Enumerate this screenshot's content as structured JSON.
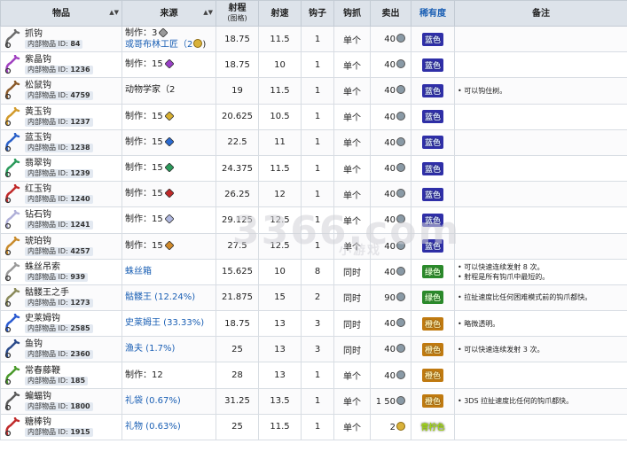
{
  "headers": {
    "item": "物品",
    "source": "来源",
    "range": "射程",
    "range_sub": "(图格)",
    "velocity": "射速",
    "hooks": "钩子",
    "latching": "钩抓",
    "sell": "卖出",
    "rarity": "稀有度",
    "notes": "备注"
  },
  "watermark": "3366.com",
  "watermark_sub": "小游戏",
  "rows": [
    {
      "name": "抓钩",
      "id_label": "内部物品 ID:",
      "id": "84",
      "src1": "制作：3",
      "src2": "或哥布林工匠（2",
      "range": "18.75",
      "vel": "11.5",
      "hooks": "1",
      "latch": "单个",
      "sell": "40",
      "rarity": "蓝色",
      "note1": "",
      "note2": ""
    },
    {
      "name": "紫晶钩",
      "id_label": "内部物品 ID:",
      "id": "1236",
      "src1": "制作：15",
      "src2": "",
      "range": "18.75",
      "vel": "10",
      "hooks": "1",
      "latch": "单个",
      "sell": "40",
      "rarity": "蓝色",
      "note1": "",
      "note2": ""
    },
    {
      "name": "松鼠钩",
      "id_label": "内部物品 ID:",
      "id": "4759",
      "src1": "动物学家（2",
      "src2": "",
      "range": "19",
      "vel": "11.5",
      "hooks": "1",
      "latch": "单个",
      "sell": "40",
      "rarity": "蓝色",
      "note1": "可以钩住树。",
      "note2": ""
    },
    {
      "name": "黄玉钩",
      "id_label": "内部物品 ID:",
      "id": "1237",
      "src1": "制作：15",
      "src2": "",
      "range": "20.625",
      "vel": "10.5",
      "hooks": "1",
      "latch": "单个",
      "sell": "40",
      "rarity": "蓝色",
      "note1": "",
      "note2": ""
    },
    {
      "name": "蓝玉钩",
      "id_label": "内部物品 ID:",
      "id": "1238",
      "src1": "制作：15",
      "src2": "",
      "range": "22.5",
      "vel": "11",
      "hooks": "1",
      "latch": "单个",
      "sell": "40",
      "rarity": "蓝色",
      "note1": "",
      "note2": ""
    },
    {
      "name": "翡翠钩",
      "id_label": "内部物品 ID:",
      "id": "1239",
      "src1": "制作：15",
      "src2": "",
      "range": "24.375",
      "vel": "11.5",
      "hooks": "1",
      "latch": "单个",
      "sell": "40",
      "rarity": "蓝色",
      "note1": "",
      "note2": ""
    },
    {
      "name": "红玉钩",
      "id_label": "内部物品 ID:",
      "id": "1240",
      "src1": "制作：15",
      "src2": "",
      "range": "26.25",
      "vel": "12",
      "hooks": "1",
      "latch": "单个",
      "sell": "40",
      "rarity": "蓝色",
      "note1": "",
      "note2": ""
    },
    {
      "name": "钻石钩",
      "id_label": "内部物品 ID:",
      "id": "1241",
      "src1": "制作：15",
      "src2": "",
      "range": "29.125",
      "vel": "12.5",
      "hooks": "1",
      "latch": "单个",
      "sell": "40",
      "rarity": "蓝色",
      "note1": "",
      "note2": ""
    },
    {
      "name": "琥珀钩",
      "id_label": "内部物品 ID:",
      "id": "4257",
      "src1": "制作：15",
      "src2": "",
      "range": "27.5",
      "vel": "12.5",
      "hooks": "1",
      "latch": "单个",
      "sell": "40",
      "rarity": "蓝色",
      "note1": "",
      "note2": ""
    },
    {
      "name": "蛛丝吊索",
      "id_label": "内部物品 ID:",
      "id": "939",
      "src1": "蛛丝箱",
      "src2": "",
      "range": "15.625",
      "vel": "10",
      "hooks": "8",
      "latch": "同时",
      "sell": "40",
      "rarity": "绿色",
      "note1": "可以快速连续发射 8 次。",
      "note2": "射程是所有钩爪中最短的。"
    },
    {
      "name": "骷髅王之手",
      "id_label": "内部物品 ID:",
      "id": "1273",
      "src1": "骷髅王 (12.24%)",
      "src2": "",
      "range": "21.875",
      "vel": "15",
      "hooks": "2",
      "latch": "同时",
      "sell": "90",
      "rarity": "绿色",
      "note1": "拉扯速度比任何困难模式前的钩爪都快。",
      "note2": ""
    },
    {
      "name": "史莱姆钩",
      "id_label": "内部物品 ID:",
      "id": "2585",
      "src1": "史莱姆王 (33.33%)",
      "src2": "",
      "range": "18.75",
      "vel": "13",
      "hooks": "3",
      "latch": "同时",
      "sell": "40",
      "rarity": "橙色",
      "note1": "略微透明。",
      "note2": ""
    },
    {
      "name": "鱼钩",
      "id_label": "内部物品 ID:",
      "id": "2360",
      "src1": "渔夫 (1.7%)",
      "src2": "",
      "range": "25",
      "vel": "13",
      "hooks": "3",
      "latch": "同时",
      "sell": "40",
      "rarity": "橙色",
      "note1": "可以快速连续发射 3 次。",
      "note2": ""
    },
    {
      "name": "常春藤鞭",
      "id_label": "内部物品 ID:",
      "id": "185",
      "src1": "制作：12",
      "src2": "",
      "range": "28",
      "vel": "13",
      "hooks": "1",
      "latch": "单个",
      "sell": "40",
      "rarity": "橙色",
      "note1": "",
      "note2": ""
    },
    {
      "name": "蝙蝠钩",
      "id_label": "内部物品 ID:",
      "id": "1800",
      "src1": "礼袋 (0.67%)",
      "src2": "",
      "range": "31.25",
      "vel": "13.5",
      "hooks": "1",
      "latch": "单个",
      "sell": "1 50",
      "rarity": "橙色",
      "note1": "3DS 拉扯速度比任何的钩爪都快。",
      "note2": ""
    },
    {
      "name": "糖棒钩",
      "id_label": "内部物品 ID:",
      "id": "1915",
      "src1": "礼物 (0.63%)",
      "src2": "",
      "range": "25",
      "vel": "11.5",
      "hooks": "1",
      "latch": "单个",
      "sell": "2",
      "rarity": "青柠色",
      "note1": "",
      "note2": ""
    }
  ],
  "colors": {
    "hooks": [
      "#6b6b6b",
      "#a040c0",
      "#8a5a2a",
      "#d29a2a",
      "#2a60c8",
      "#2a9a5a",
      "#c02828",
      "#b0b0d8",
      "#c88a2a",
      "#9a9a9a",
      "#8a8a5a",
      "#2a5ad0",
      "#2a4a8a",
      "#4a9a2a",
      "#5a5a5a",
      "#c02a2a"
    ],
    "gems": [
      "#9a9a9a",
      "#9a40c8",
      "#d8b030",
      "#d89a2a",
      "#2a6ad0",
      "#2a9a5a",
      "#c02828",
      "#b0b8e0",
      "#d08a2a"
    ],
    "rarity_blue": "#2f2fa8",
    "rarity_green": "#2b8a2b",
    "rarity_orange": "#c07a10",
    "rarity_lime": "#9fd11a"
  }
}
